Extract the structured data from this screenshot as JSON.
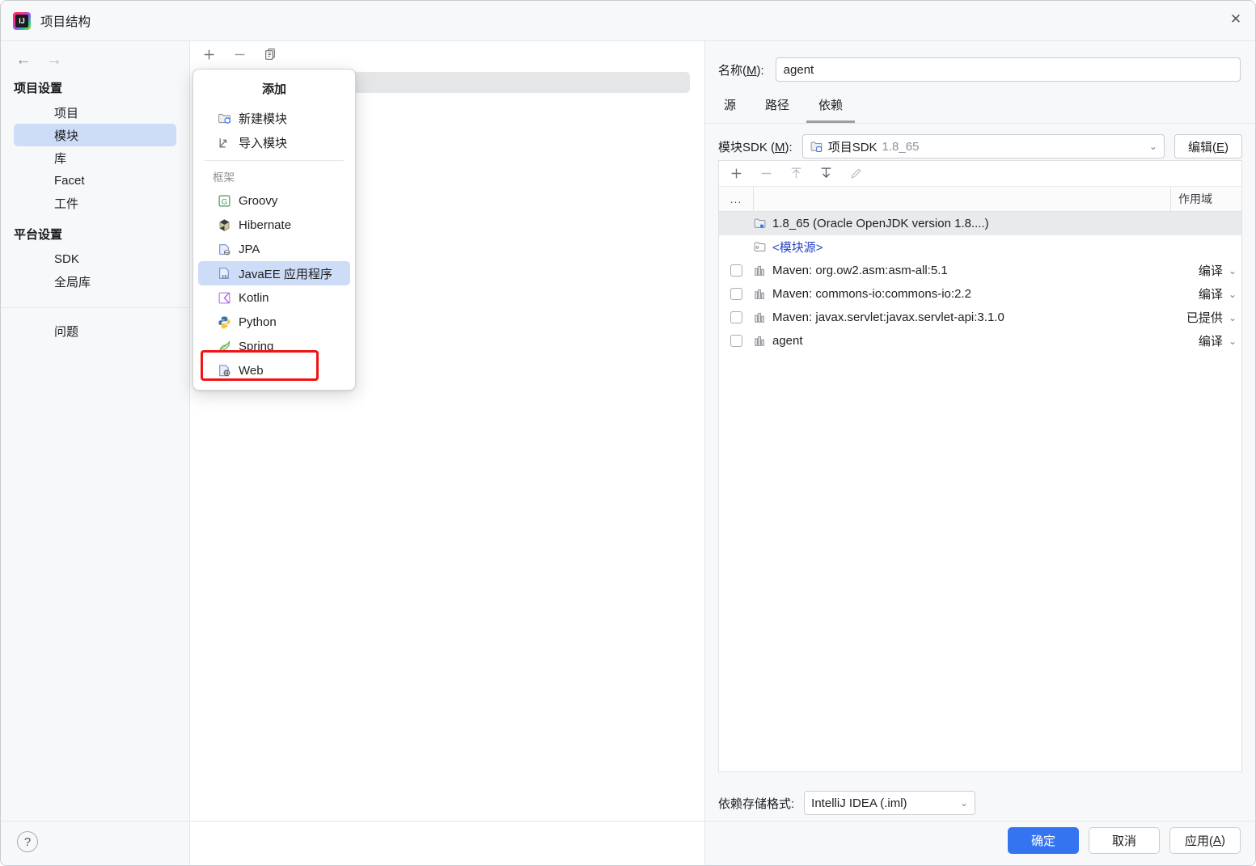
{
  "window": {
    "title": "项目结构",
    "app_icon": "intellij-idea-icon",
    "close_label": "✕"
  },
  "sidebar": {
    "back_arrow": "←",
    "forward_arrow": "→",
    "groups": [
      {
        "title": "项目设置",
        "items": [
          {
            "label": "项目",
            "selected": false
          },
          {
            "label": "模块",
            "selected": true
          },
          {
            "label": "库",
            "selected": false
          },
          {
            "label": "Facet",
            "selected": false
          },
          {
            "label": "工件",
            "selected": false
          }
        ]
      },
      {
        "title": "平台设置",
        "items": [
          {
            "label": "SDK",
            "selected": false
          },
          {
            "label": "全局库",
            "selected": false
          }
        ]
      }
    ],
    "standalone_item": {
      "label": "问题"
    }
  },
  "middle": {
    "toolbar": [
      {
        "name": "add-module-button",
        "glyph": "＋"
      },
      {
        "name": "remove-module-button",
        "glyph": "－"
      },
      {
        "name": "copy-module-button",
        "glyph": "copy"
      }
    ]
  },
  "add_popup": {
    "title": "添加",
    "top_items": [
      {
        "label": "新建模块",
        "icon": "new-module-icon"
      },
      {
        "label": "导入模块",
        "icon": "import-module-icon"
      }
    ],
    "group_label": "框架",
    "framework_items": [
      {
        "label": "Groovy",
        "icon": "groovy-icon",
        "selected": false
      },
      {
        "label": "Hibernate",
        "icon": "hibernate-icon",
        "selected": false
      },
      {
        "label": "JPA",
        "icon": "jpa-icon",
        "selected": false
      },
      {
        "label": "JavaEE 应用程序",
        "icon": "javaee-icon",
        "selected": true
      },
      {
        "label": "Kotlin",
        "icon": "kotlin-icon",
        "selected": false
      },
      {
        "label": "Python",
        "icon": "python-icon",
        "selected": false
      },
      {
        "label": "Spring",
        "icon": "spring-icon",
        "selected": false
      },
      {
        "label": "Web",
        "icon": "web-icon",
        "selected": false,
        "annotated": true
      }
    ]
  },
  "annotation": {
    "color": "#f11414",
    "target": "Web"
  },
  "right": {
    "name_label_pre": "名称(",
    "name_label_key": "M",
    "name_label_post": "):",
    "name_value": "agent",
    "tabs": [
      {
        "label": "源",
        "active": false
      },
      {
        "label": "路径",
        "active": false
      },
      {
        "label": "依赖",
        "active": true
      }
    ],
    "sdk_label_pre": "模块SDK (",
    "sdk_label_key": "M",
    "sdk_label_post": "):",
    "sdk_value_main": "项目SDK",
    "sdk_value_version": "1.8_65",
    "sdk_icon": "sdk-folder-icon",
    "edit_button_pre": "编辑(",
    "edit_button_key": "E",
    "edit_button_post": ")",
    "dep_toolbar": [
      {
        "name": "add-dependency-button",
        "glyph": "＋",
        "enabled": true
      },
      {
        "name": "remove-dependency-button",
        "glyph": "－",
        "enabled": false
      },
      {
        "name": "move-up-button",
        "glyph": "↑",
        "enabled": false
      },
      {
        "name": "move-down-button",
        "glyph": "↓",
        "enabled": true
      },
      {
        "name": "edit-dependency-button",
        "glyph": "✎",
        "enabled": false
      }
    ],
    "table": {
      "headers": {
        "dots": "...",
        "name": "",
        "scope": "作用域"
      },
      "rows": [
        {
          "checkbox": false,
          "show_checkbox": false,
          "icon": "sdk-icon",
          "name": "1.8_65 (Oracle OpenJDK version 1.8....)",
          "scope": "",
          "selected": true,
          "link": false
        },
        {
          "checkbox": false,
          "show_checkbox": false,
          "icon": "module-source-icon",
          "name": "<模块源>",
          "scope": "",
          "selected": false,
          "link": true
        },
        {
          "checkbox": false,
          "show_checkbox": true,
          "icon": "library-icon",
          "name": "Maven: org.ow2.asm:asm-all:5.1",
          "scope": "编译",
          "selected": false,
          "link": false
        },
        {
          "checkbox": false,
          "show_checkbox": true,
          "icon": "library-icon",
          "name": "Maven: commons-io:commons-io:2.2",
          "scope": "编译",
          "selected": false,
          "link": false
        },
        {
          "checkbox": false,
          "show_checkbox": true,
          "icon": "library-icon",
          "name": "Maven: javax.servlet:javax.servlet-api:3.1.0",
          "scope": "已提供",
          "selected": false,
          "link": false
        },
        {
          "checkbox": false,
          "show_checkbox": true,
          "icon": "library-icon",
          "name": "agent",
          "scope": "编译",
          "selected": false,
          "link": false
        }
      ]
    },
    "storage_label": "依赖存储格式:",
    "storage_value": "IntelliJ IDEA (.iml)"
  },
  "footer": {
    "help_glyph": "?",
    "ok_label": "确定",
    "cancel_label": "取消",
    "apply_pre": "应用(",
    "apply_key": "A",
    "apply_post": ")",
    "primary_color": "#3574f0"
  }
}
